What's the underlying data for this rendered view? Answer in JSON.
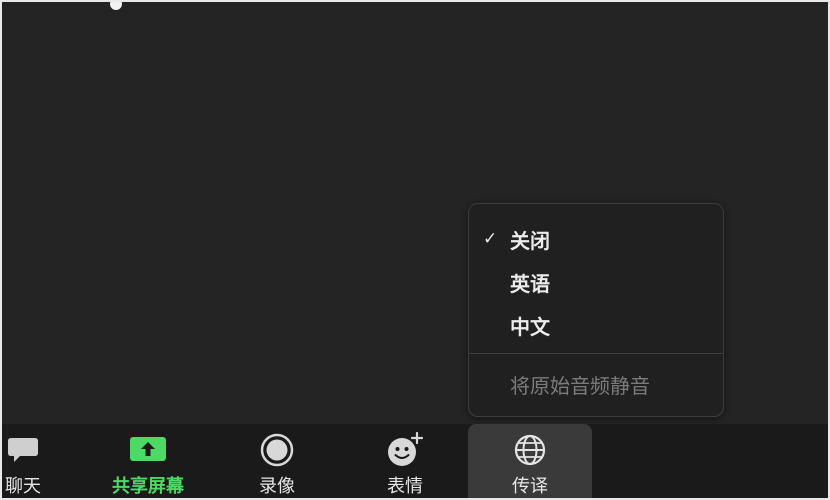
{
  "menu": {
    "items": [
      {
        "label": "关闭",
        "checked": true,
        "check_mark": "✓"
      },
      {
        "label": "英语",
        "checked": false,
        "check_mark": ""
      },
      {
        "label": "中文",
        "checked": false,
        "check_mark": ""
      }
    ],
    "mute_original": {
      "label": "将原始音频静音",
      "enabled": false
    }
  },
  "toolbar": {
    "chat": {
      "label": "聊天",
      "icon": "chat-bubble-icon"
    },
    "share": {
      "label": "共享屏幕",
      "icon": "share-screen-arrow-icon",
      "color": "#4cd964"
    },
    "record": {
      "label": "录像",
      "icon": "record-circle-icon"
    },
    "reactions": {
      "label": "表情",
      "icon": "emoji-plus-icon"
    },
    "interpretation": {
      "label": "传译",
      "icon": "globe-icon",
      "selected": true
    }
  },
  "colors": {
    "background": "#242424",
    "toolbar": "#1a1a1a",
    "accent_green": "#4cd964"
  }
}
